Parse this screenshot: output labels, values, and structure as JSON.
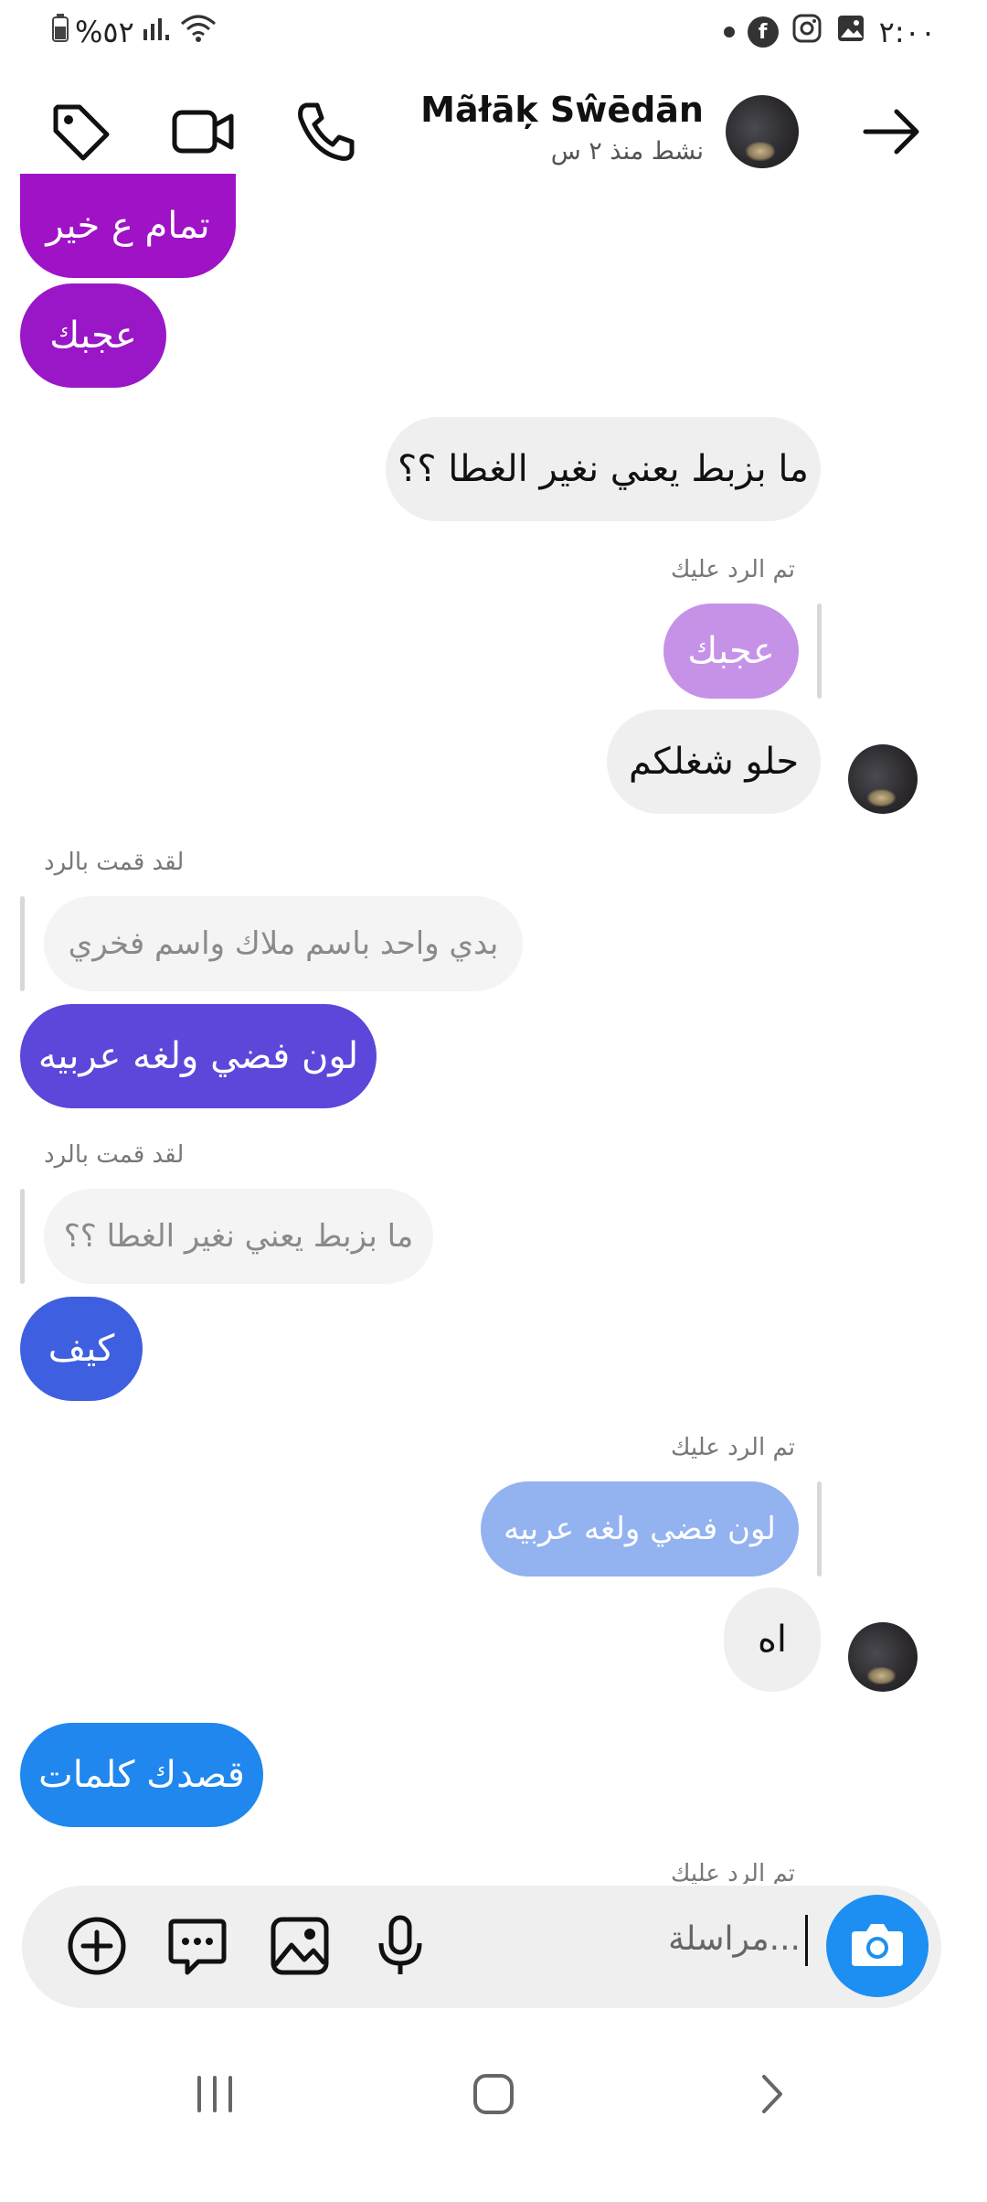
{
  "status_bar": {
    "time": "٢:٠٠",
    "battery": "%٥٢",
    "notifications": [
      "dot",
      "facebook-icon",
      "instagram-icon",
      "gallery-icon"
    ]
  },
  "header": {
    "name": "Mãłāķ Sŵēdān",
    "status": "نشط منذ ٢ س"
  },
  "messages": {
    "m1": "تمام ع خير",
    "m2": "عجبك",
    "m3": "ما بزبط يعني نغير الغطا ؟؟",
    "m4_label": "تم الرد عليك",
    "m4_quote": "عجبك",
    "m5": "حلو شغلكم",
    "m6_label": "لقد قمت بالرد",
    "m6_quote": "بدي واحد باسم ملاك  واسم فخري",
    "m6": "لون فضي ولغه عربيه",
    "m7_label": "لقد قمت بالرد",
    "m7_quote": "ما بزبط يعني نغير الغطا ؟؟",
    "m7": "كيف",
    "m8_label": "تم الرد عليك",
    "m8_quote": "لون فضي ولغه عربيه",
    "m9": "اه",
    "m10": "قصدك كلمات",
    "m11_label": "تم الرد عليك"
  },
  "composer": {
    "placeholder": "مراسلة..."
  },
  "colors": {
    "gradient_purple": "#9b14c4",
    "gradient_indigo": "#5c46d8",
    "gradient_blue": "#3f5ede",
    "gradient_sky": "#1f86ee",
    "theirs_bubble": "#efefef",
    "camera": "#1d8ff2"
  }
}
